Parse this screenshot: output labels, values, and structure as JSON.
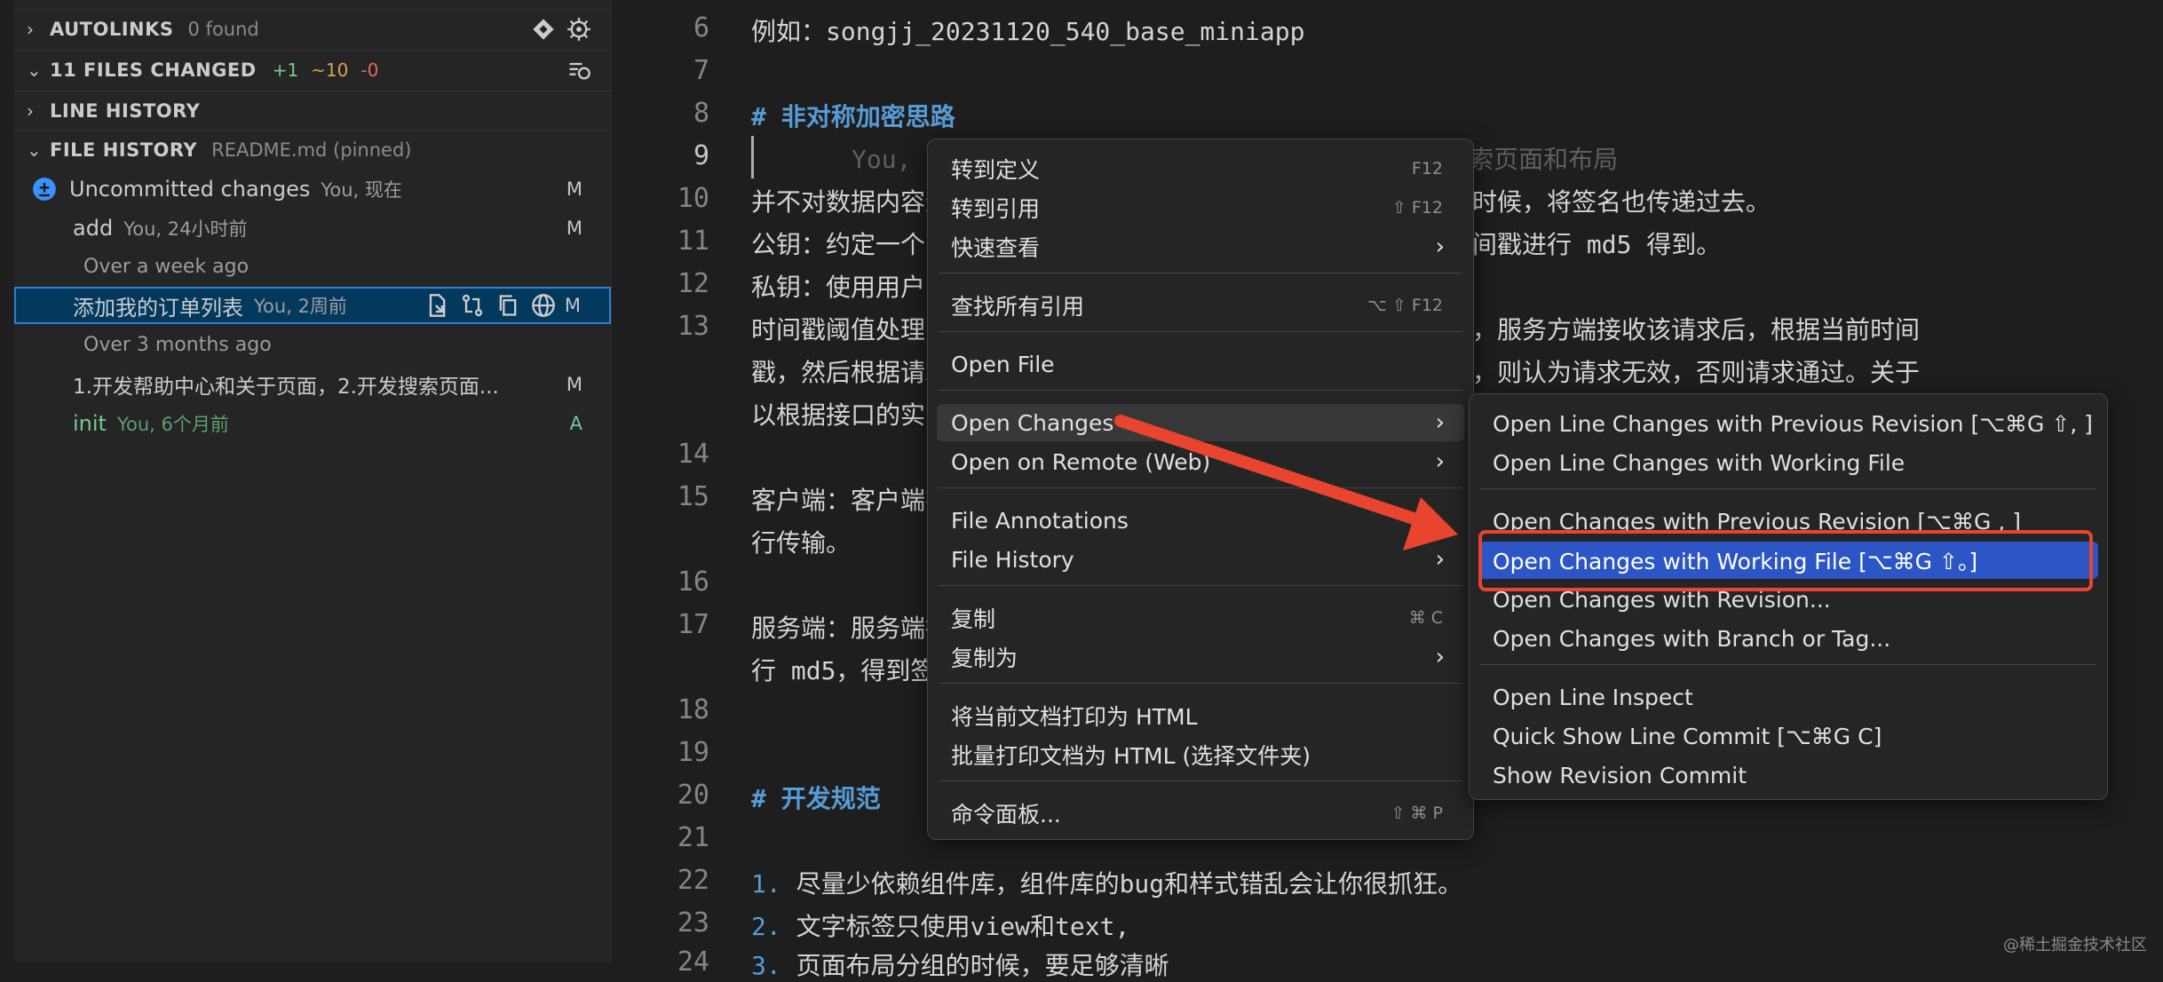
{
  "sidebar": {
    "autolinks": {
      "title": "AUTOLINKS",
      "extra": "0 found"
    },
    "files_changed": {
      "title": "11 FILES CHANGED",
      "add": "+1",
      "mod": "~10",
      "del": "-0"
    },
    "line_history": {
      "title": "LINE HISTORY"
    },
    "file_history": {
      "title": "FILE HISTORY",
      "extra": "README.md (pinned)"
    },
    "items": [
      {
        "label": "Uncommitted changes",
        "sub": "You, 现在",
        "status": "M"
      },
      {
        "label": "add",
        "sub": "You, 24小时前",
        "status": "M"
      },
      {
        "group": "Over a week ago"
      },
      {
        "label": "添加我的订单列表",
        "sub": "You, 2周前",
        "status": "M"
      },
      {
        "group": "Over 3 months ago"
      },
      {
        "label": "1.开发帮助中心和关于页面，2.开发搜索页面...",
        "status": "M"
      },
      {
        "label": "init",
        "sub": "You, 6个月前",
        "status": "A"
      }
    ]
  },
  "editor": {
    "lines": [
      {
        "n": "6",
        "text": "例如：songjj_20231120_540_base_miniapp"
      },
      {
        "n": "7",
        "text": ""
      },
      {
        "n": "8",
        "text": "# 非对称加密思路"
      },
      {
        "n": "9",
        "text": "You, 2周前 · 1.开发帮助中心和关于页面，2.开发搜索页面和布局"
      },
      {
        "n": "10",
        "text": "并不对数据内容进行加密，只是对数据进行签名，然后传递数据的时候，将签名也传递过去。"
      },
      {
        "n": "11",
        "text": "公钥：约定一个字符串，由客户端和服务端根据请求地址和分钟时间戳进行 md5 得到。"
      },
      {
        "n": "12",
        "text": "私钥：使用用户 token 作为私钥。"
      },
      {
        "n": "13",
        "text": "时间戳阈值处理：客户端在请求头中带上时间戳，表示请求时间戳，服务方端接收该请求后，根据当前时间"
      },
      {
        "n": "",
        "text": "戳，然后根据请求时间戳计算时间差，如果时间差大于指定的阈值，则认为请求无效，否则请求通过。关于"
      },
      {
        "n": "",
        "text": "以根据接口的实际情况来设置。"
      },
      {
        "n": "14",
        "text": ""
      },
      {
        "n": "15",
        "text": "客户端：客户端在发送请求时，将请求参数按照约定规则进行排序并拼接，然后对"
      },
      {
        "n": "",
        "text": "行传输。"
      },
      {
        "n": "16",
        "text": ""
      },
      {
        "n": "17",
        "text": "服务端：服务端接收到请求后，获取请求参数、请求头中的时间戳以及请求体 bo"
      },
      {
        "n": "",
        "text": "行 md5，得到签名，然后与请求中传递的签名进行比较，一致则认为请求有效。"
      },
      {
        "n": "18",
        "text": ""
      },
      {
        "n": "19",
        "text": ""
      },
      {
        "n": "20",
        "text": "# 开发规范"
      },
      {
        "n": "21",
        "text": ""
      },
      {
        "n": "22",
        "num": "1.",
        "text": "尽量少依赖组件库，组件库的bug和样式错乱会让你很抓狂。"
      },
      {
        "n": "23",
        "num": "2.",
        "text": "文字标签只使用view和text,"
      },
      {
        "n": "24",
        "num": "3.",
        "text": "页面布局分组的时候，要足够清晰"
      }
    ]
  },
  "context_menu": {
    "items": [
      {
        "label": "转到定义",
        "key": "F12"
      },
      {
        "label": "转到引用",
        "key": "⇧ F12"
      },
      {
        "label": "快速查看",
        "submenu": true
      },
      {
        "label": "查找所有引用",
        "key": "⌥ ⇧ F12"
      },
      {
        "label": "Open File"
      },
      {
        "label": "Open Changes",
        "submenu": true
      },
      {
        "label": "Open on Remote (Web)",
        "submenu": true
      },
      {
        "label": "File Annotations",
        "submenu": true
      },
      {
        "label": "File History",
        "submenu": true
      },
      {
        "label": "复制",
        "key": "⌘ C"
      },
      {
        "label": "复制为",
        "submenu": true
      },
      {
        "label": "将当前文档打印为 HTML"
      },
      {
        "label": "批量打印文档为 HTML (选择文件夹)"
      },
      {
        "label": "命令面板...",
        "key": "⇧ ⌘ P"
      }
    ],
    "submenu": [
      {
        "label": "Open Line Changes with Previous Revision [⌥⌘G ⇧, ]"
      },
      {
        "label": "Open Line Changes with Working File"
      },
      {
        "label": "Open Changes with Previous Revision [⌥⌘G , ]"
      },
      {
        "label": "Open Changes with Working File [⌥⌘G ⇧。]"
      },
      {
        "label": "Open Changes with Revision..."
      },
      {
        "label": "Open Changes with Branch or Tag..."
      },
      {
        "label": "Open Line Inspect"
      },
      {
        "label": "Quick Show Line Commit [⌥⌘G C]"
      },
      {
        "label": "Show Revision Commit"
      }
    ]
  },
  "watermark": "@稀土掘金技术社区",
  "colors": {
    "accent": "#2c55c6",
    "annotation": "#e8442e",
    "heading": "#569cd6"
  }
}
